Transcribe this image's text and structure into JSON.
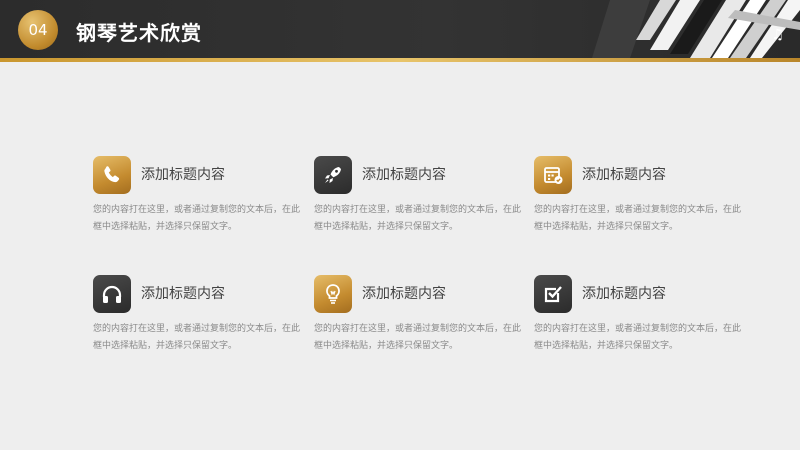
{
  "header": {
    "number": "04",
    "title": "钢琴艺术欣赏"
  },
  "items": [
    {
      "title": "添加标题内容",
      "desc": "您的内容打在这里，或者通过复制您的文本后，在此框中选择粘贴，并选择只保留文字。",
      "icon": "phone-icon",
      "style": "gold"
    },
    {
      "title": "添加标题内容",
      "desc": "您的内容打在这里，或者通过复制您的文本后，在此框中选择粘贴，并选择只保留文字。",
      "icon": "rocket-icon",
      "style": "dark"
    },
    {
      "title": "添加标题内容",
      "desc": "您的内容打在这里，或者通过复制您的文本后，在此框中选择粘贴，并选择只保留文字。",
      "icon": "calendar-check-icon",
      "style": "gold"
    },
    {
      "title": "添加标题内容",
      "desc": "您的内容打在这里，或者通过复制您的文本后，在此框中选择粘贴，并选择只保留文字。",
      "icon": "headphones-icon",
      "style": "dark"
    },
    {
      "title": "添加标题内容",
      "desc": "您的内容打在这里，或者通过复制您的文本后，在此框中选择粘贴，并选择只保留文字。",
      "icon": "lightbulb-icon",
      "style": "gold"
    },
    {
      "title": "添加标题内容",
      "desc": "您的内容打在这里，或者通过复制您的文本后，在此框中选择粘贴，并选择只保留文字。",
      "icon": "checkbox-icon",
      "style": "dark"
    }
  ],
  "colors": {
    "gold": "#c9962e",
    "dark": "#2f2f2f",
    "background": "#eeeeee"
  }
}
